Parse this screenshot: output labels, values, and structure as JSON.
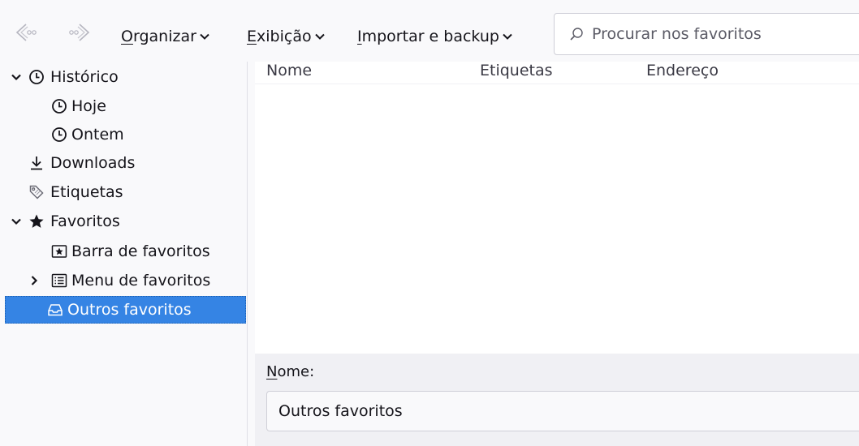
{
  "toolbar": {
    "organize": {
      "accel": "O",
      "rest": "rganizar"
    },
    "view": {
      "accel": "E",
      "rest": "xibição"
    },
    "import": {
      "accel": "I",
      "rest": "mportar e backup"
    },
    "search_placeholder": "Procurar nos favoritos"
  },
  "sidebar": {
    "history": "Histórico",
    "today": "Hoje",
    "yesterday": "Ontem",
    "downloads": "Downloads",
    "tags": "Etiquetas",
    "bookmarks": "Favoritos",
    "bookmarks_toolbar": "Barra de favoritos",
    "bookmarks_menu": "Menu de favoritos",
    "other_bookmarks": "Outros favoritos"
  },
  "columns": {
    "name": "Nome",
    "tags": "Etiquetas",
    "location": "Endereço"
  },
  "details": {
    "name_label": {
      "accel": "N",
      "rest": "ome:"
    },
    "name_value": "Outros favoritos"
  },
  "colors": {
    "selection": "#3584e4",
    "background": "#f9f9fb"
  }
}
